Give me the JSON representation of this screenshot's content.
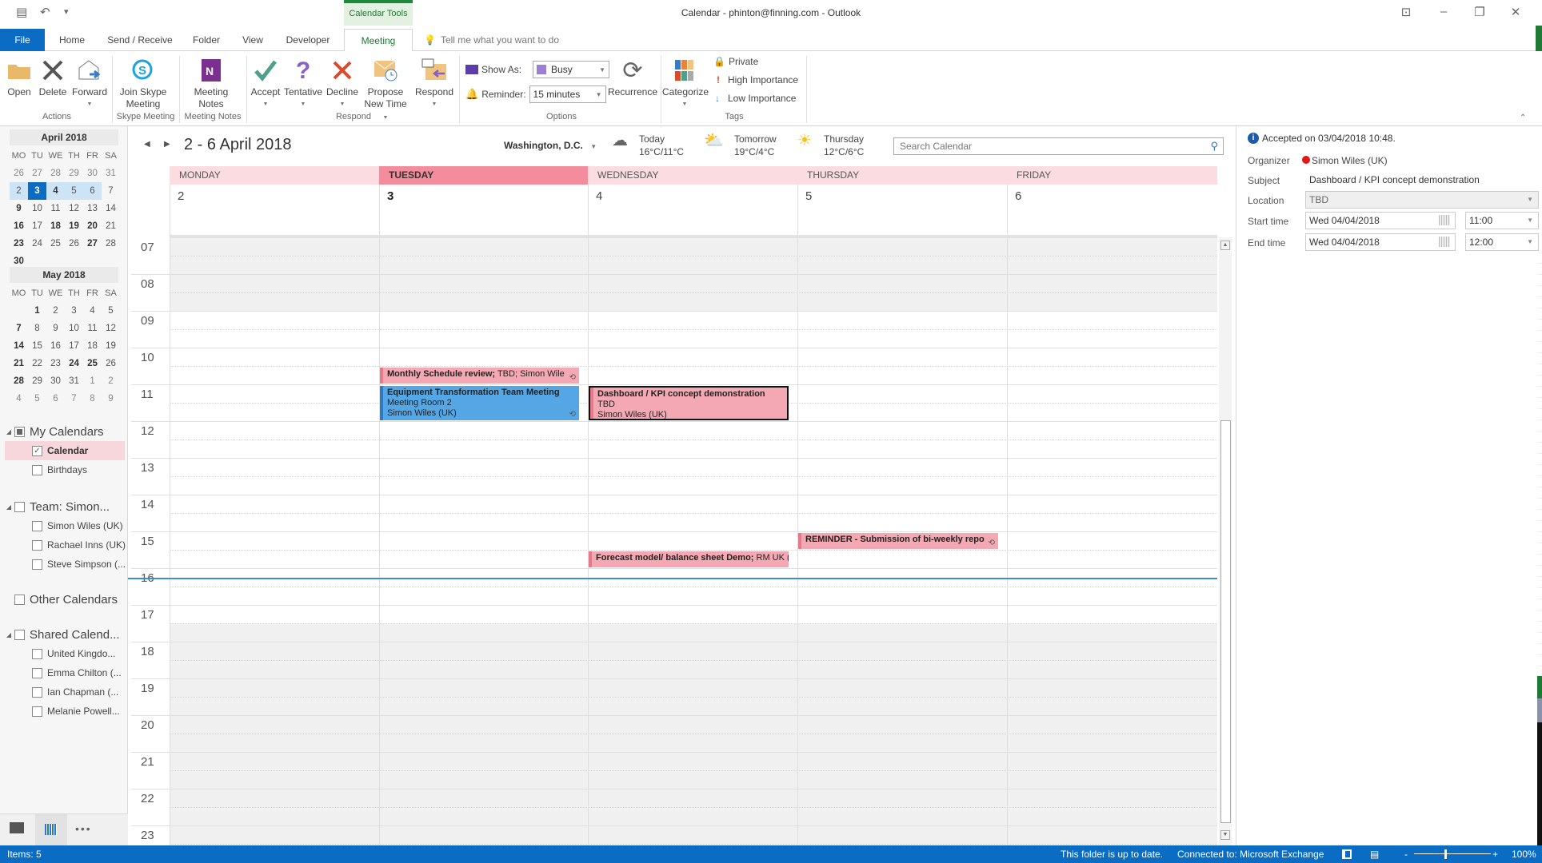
{
  "window": {
    "title": "Calendar - phinton@finning.com  -  Outlook",
    "controls": [
      "ribbon-display-options",
      "minimize",
      "restore",
      "close"
    ]
  },
  "ribbon_tabs": {
    "contextual_header": "Calendar Tools",
    "file": "File",
    "home": "Home",
    "send_receive": "Send / Receive",
    "folder": "Folder",
    "view": "View",
    "developer": "Developer",
    "meeting": "Meeting",
    "tell_me": "Tell me what you want to do"
  },
  "ribbon": {
    "actions": {
      "open": "Open",
      "delete": "Delete",
      "forward": "Forward",
      "group": "Actions"
    },
    "skype": {
      "join_line1": "Join Skype",
      "join_line2": "Meeting",
      "group": "Skype Meeting"
    },
    "notes": {
      "line1": "Meeting",
      "line2": "Notes",
      "group": "Meeting Notes"
    },
    "respond": {
      "accept": "Accept",
      "tentative": "Tentative",
      "decline": "Decline",
      "propose_line1": "Propose",
      "propose_line2": "New Time",
      "respond": "Respond",
      "group": "Respond"
    },
    "options": {
      "show_as_label": "Show As:",
      "show_as_value": "Busy",
      "show_as_color": "#9b7fd4",
      "reminder_label": "Reminder:",
      "reminder_value": "15 minutes",
      "recurrence": "Recurrence",
      "group": "Options"
    },
    "tags": {
      "categorize": "Categorize",
      "private": "Private",
      "high": "High Importance",
      "low": "Low Importance",
      "group": "Tags"
    }
  },
  "mini_calendars": [
    {
      "title": "April 2018",
      "days_header": [
        "MO",
        "TU",
        "WE",
        "TH",
        "FR",
        "SA"
      ],
      "cells": [
        {
          "d": "26",
          "s": "g"
        },
        {
          "d": "27",
          "s": "g"
        },
        {
          "d": "28",
          "s": "g"
        },
        {
          "d": "29",
          "s": "g"
        },
        {
          "d": "30",
          "s": "g"
        },
        {
          "d": "31",
          "s": "g"
        },
        {
          "d": "2",
          "s": "sel"
        },
        {
          "d": "3",
          "s": "today"
        },
        {
          "d": "4",
          "s": "sel b"
        },
        {
          "d": "5",
          "s": "sel"
        },
        {
          "d": "6",
          "s": "sel"
        },
        {
          "d": "7",
          "s": ""
        },
        {
          "d": "9",
          "s": "b"
        },
        {
          "d": "10",
          "s": ""
        },
        {
          "d": "11",
          "s": ""
        },
        {
          "d": "12",
          "s": ""
        },
        {
          "d": "13",
          "s": ""
        },
        {
          "d": "14",
          "s": ""
        },
        {
          "d": "16",
          "s": "b"
        },
        {
          "d": "17",
          "s": ""
        },
        {
          "d": "18",
          "s": "b"
        },
        {
          "d": "19",
          "s": "b"
        },
        {
          "d": "20",
          "s": "b"
        },
        {
          "d": "21",
          "s": ""
        },
        {
          "d": "23",
          "s": "b"
        },
        {
          "d": "24",
          "s": ""
        },
        {
          "d": "25",
          "s": ""
        },
        {
          "d": "26",
          "s": ""
        },
        {
          "d": "27",
          "s": "b"
        },
        {
          "d": "28",
          "s": ""
        },
        {
          "d": "30",
          "s": "b"
        },
        {
          "d": "",
          "s": ""
        },
        {
          "d": "",
          "s": ""
        },
        {
          "d": "",
          "s": ""
        },
        {
          "d": "",
          "s": ""
        },
        {
          "d": "",
          "s": ""
        }
      ]
    },
    {
      "title": "May 2018",
      "days_header": [
        "MO",
        "TU",
        "WE",
        "TH",
        "FR",
        "SA"
      ],
      "cells": [
        {
          "d": "",
          "s": ""
        },
        {
          "d": "1",
          "s": "b"
        },
        {
          "d": "2",
          "s": ""
        },
        {
          "d": "3",
          "s": ""
        },
        {
          "d": "4",
          "s": ""
        },
        {
          "d": "5",
          "s": ""
        },
        {
          "d": "7",
          "s": "b"
        },
        {
          "d": "8",
          "s": ""
        },
        {
          "d": "9",
          "s": ""
        },
        {
          "d": "10",
          "s": ""
        },
        {
          "d": "11",
          "s": ""
        },
        {
          "d": "12",
          "s": ""
        },
        {
          "d": "14",
          "s": "b"
        },
        {
          "d": "15",
          "s": ""
        },
        {
          "d": "16",
          "s": ""
        },
        {
          "d": "17",
          "s": ""
        },
        {
          "d": "18",
          "s": ""
        },
        {
          "d": "19",
          "s": ""
        },
        {
          "d": "21",
          "s": "b"
        },
        {
          "d": "22",
          "s": ""
        },
        {
          "d": "23",
          "s": ""
        },
        {
          "d": "24",
          "s": "b"
        },
        {
          "d": "25",
          "s": "b"
        },
        {
          "d": "26",
          "s": ""
        },
        {
          "d": "28",
          "s": "b"
        },
        {
          "d": "29",
          "s": ""
        },
        {
          "d": "30",
          "s": ""
        },
        {
          "d": "31",
          "s": ""
        },
        {
          "d": "1",
          "s": "g"
        },
        {
          "d": "2",
          "s": "g"
        },
        {
          "d": "4",
          "s": "g"
        },
        {
          "d": "5",
          "s": "g"
        },
        {
          "d": "6",
          "s": "g"
        },
        {
          "d": "7",
          "s": "g"
        },
        {
          "d": "8",
          "s": "g"
        },
        {
          "d": "9",
          "s": "g"
        }
      ]
    }
  ],
  "folders": {
    "my_calendars": {
      "label": "My Calendars",
      "items": [
        {
          "label": "Calendar",
          "checked": true
        },
        {
          "label": "Birthdays",
          "checked": false
        }
      ]
    },
    "team": {
      "label": "Team: Simon...",
      "items": [
        {
          "label": "Simon Wiles (UK)"
        },
        {
          "label": "Rachael Inns (UK)"
        },
        {
          "label": "Steve Simpson (..."
        }
      ]
    },
    "other": {
      "label": "Other Calendars"
    },
    "shared": {
      "label": "Shared Calend...",
      "items": [
        {
          "label": "United Kingdo..."
        },
        {
          "label": "Emma Chilton (..."
        },
        {
          "label": "Ian Chapman (..."
        },
        {
          "label": "Melanie Powell..."
        }
      ]
    }
  },
  "calendar": {
    "range": "2 - 6 April 2018",
    "location": "Washington,  D.C.",
    "weather": [
      {
        "day": "Today",
        "temp": "16°C/11°C",
        "icon": "cloudy-icon"
      },
      {
        "day": "Tomorrow",
        "temp": "19°C/4°C",
        "icon": "partly-sunny-icon"
      },
      {
        "day": "Thursday",
        "temp": "12°C/6°C",
        "icon": "sunny-icon"
      }
    ],
    "search_placeholder": "Search Calendar",
    "days": [
      {
        "name": "MONDAY",
        "num": "2",
        "current": false
      },
      {
        "name": "TUESDAY",
        "num": "3",
        "current": true
      },
      {
        "name": "WEDNESDAY",
        "num": "4",
        "current": false
      },
      {
        "name": "THURSDAY",
        "num": "5",
        "current": false
      },
      {
        "name": "FRIDAY",
        "num": "6",
        "current": false
      }
    ],
    "hours": [
      "07",
      "08",
      "09",
      "10",
      "11",
      "12",
      "13",
      "14",
      "15",
      "16",
      "17",
      "18",
      "19",
      "20",
      "21",
      "22",
      "23"
    ],
    "appointments": [
      {
        "title": "Monthly Schedule review;",
        "rest": " TBD; Simon Wile",
        "day": 1,
        "start": 10.5,
        "end": 11.0,
        "color": "pink",
        "recurring": true
      },
      {
        "title": "Equipment Transformation Team Meeting",
        "line2": "Meeting Room 2",
        "line3": "Simon Wiles (UK)",
        "day": 1,
        "start": 11.0,
        "end": 12.0,
        "color": "blue",
        "recurring": true
      },
      {
        "title": "Dashboard / KPI concept demonstration",
        "line2": "TBD",
        "line3": "Simon Wiles (UK)",
        "day": 2,
        "start": 11.0,
        "end": 12.0,
        "color": "pink",
        "selected": true
      },
      {
        "title": "REMINDER - Submission of bi-weekly repo",
        "day": 3,
        "start": 15.0,
        "end": 15.5,
        "color": "pink",
        "recurring": true
      },
      {
        "title": "Forecast model/ balance sheet Demo;",
        "rest": " RM UK (",
        "day": 2,
        "start": 15.5,
        "end": 16.0,
        "color": "pink"
      }
    ],
    "current_time": 16.25
  },
  "reading_pane": {
    "info": "Accepted on 03/04/2018 10:48.",
    "organizer_label": "Organizer",
    "organizer": "Simon Wiles (UK)",
    "subject_label": "Subject",
    "subject": "Dashboard / KPI concept demonstration",
    "location_label": "Location",
    "location": "TBD",
    "start_label": "Start time",
    "start_date": "Wed 04/04/2018",
    "start_time": "11:00",
    "end_label": "End time",
    "end_date": "Wed 04/04/2018",
    "end_time": "12:00"
  },
  "status": {
    "items": "Items: 5",
    "folder_state": "This folder is up to date.",
    "connection": "Connected to: Microsoft Exchange",
    "zoom": "100%"
  }
}
